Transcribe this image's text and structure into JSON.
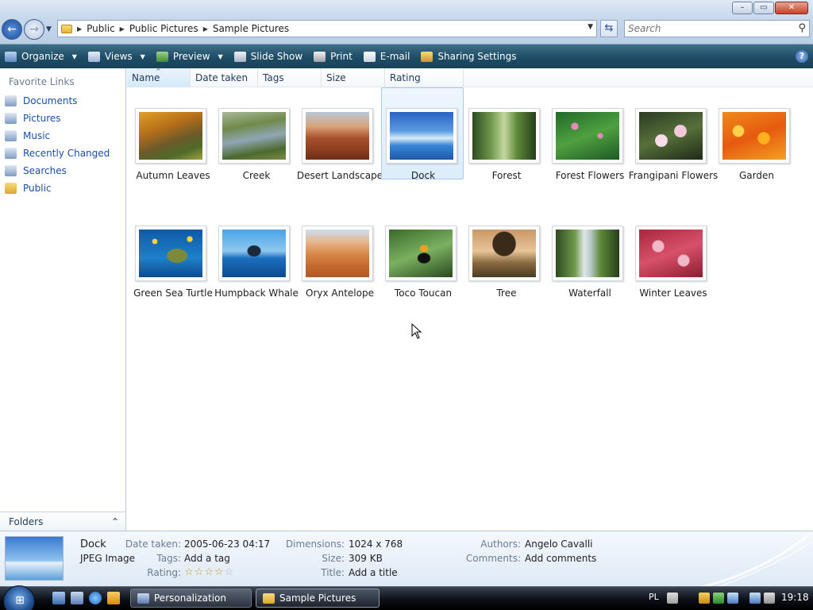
{
  "address": {
    "crumbs": [
      "Public",
      "Public Pictures",
      "Sample Pictures"
    ]
  },
  "search": {
    "placeholder": "Search"
  },
  "toolbar": {
    "organize": "Organize",
    "views": "Views",
    "preview": "Preview",
    "slideshow": "Slide Show",
    "print": "Print",
    "email": "E-mail",
    "sharing": "Sharing Settings"
  },
  "navpane": {
    "title": "Favorite Links",
    "items": [
      "Documents",
      "Pictures",
      "Music",
      "Recently Changed",
      "Searches",
      "Public"
    ],
    "folders_label": "Folders"
  },
  "columns": [
    "Name",
    "Date taken",
    "Tags",
    "Size",
    "Rating"
  ],
  "pictures": [
    "Autumn Leaves",
    "Creek",
    "Desert Landscape",
    "Dock",
    "Forest",
    "Forest Flowers",
    "Frangipani Flowers",
    "Garden",
    "Green Sea Turtle",
    "Humpback Whale",
    "Oryx Antelope",
    "Toco Toucan",
    "Tree",
    "Waterfall",
    "Winter Leaves"
  ],
  "selected_picture": "Dock",
  "details": {
    "name": "Dock",
    "type": "JPEG Image",
    "date_taken_label": "Date taken:",
    "date_taken": "2005-06-23 04:17",
    "tags_label": "Tags:",
    "tags": "Add a tag",
    "rating_label": "Rating:",
    "rating_stars": 0,
    "rating_max": 5,
    "dimensions_label": "Dimensions:",
    "dimensions": "1024 x 768",
    "size_label": "Size:",
    "size": "309 KB",
    "title_label": "Title:",
    "title": "Add a title",
    "authors_label": "Authors:",
    "authors": "Angelo Cavalli",
    "comments_label": "Comments:",
    "comments": "Add comments"
  },
  "taskbar": {
    "tasks": [
      "Personalization",
      "Sample Pictures"
    ],
    "language": "PL",
    "clock": "19:18"
  }
}
